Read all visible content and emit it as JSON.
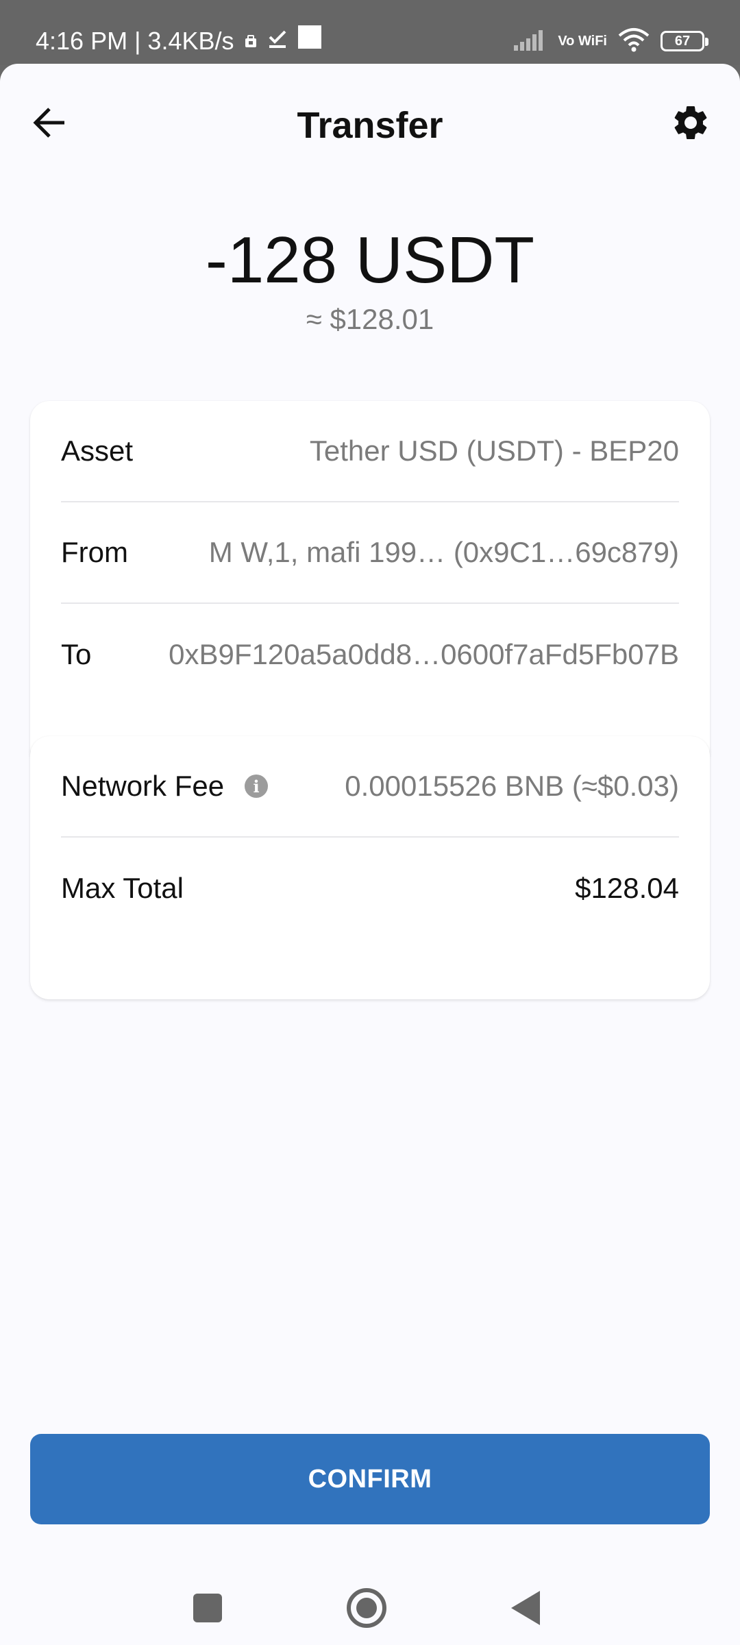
{
  "status_bar": {
    "time_speed": "4:16 PM | 3.4KB/s",
    "vowifi": "Vo WiFi",
    "battery": "67"
  },
  "header": {
    "title": "Transfer"
  },
  "summary": {
    "amount": "-128 USDT",
    "fiat": "≈ $128.01"
  },
  "details": {
    "asset_label": "Asset",
    "asset_value": "Tether USD (USDT) - BEP20",
    "from_label": "From",
    "from_value": "M W,1, mafi 199…  (0x9C1…69c879)",
    "to_label": "To",
    "to_value": "0xB9F120a5a0dd8…0600f7aFd5Fb07B"
  },
  "fees": {
    "network_fee_label": "Network Fee",
    "network_fee_value": "0.00015526 BNB (≈$0.03)",
    "max_total_label": "Max Total",
    "max_total_value": "$128.04"
  },
  "actions": {
    "confirm_label": "CONFIRM"
  },
  "colors": {
    "accent": "#3173bd",
    "background": "#fafafe",
    "status_bar": "#666666"
  }
}
